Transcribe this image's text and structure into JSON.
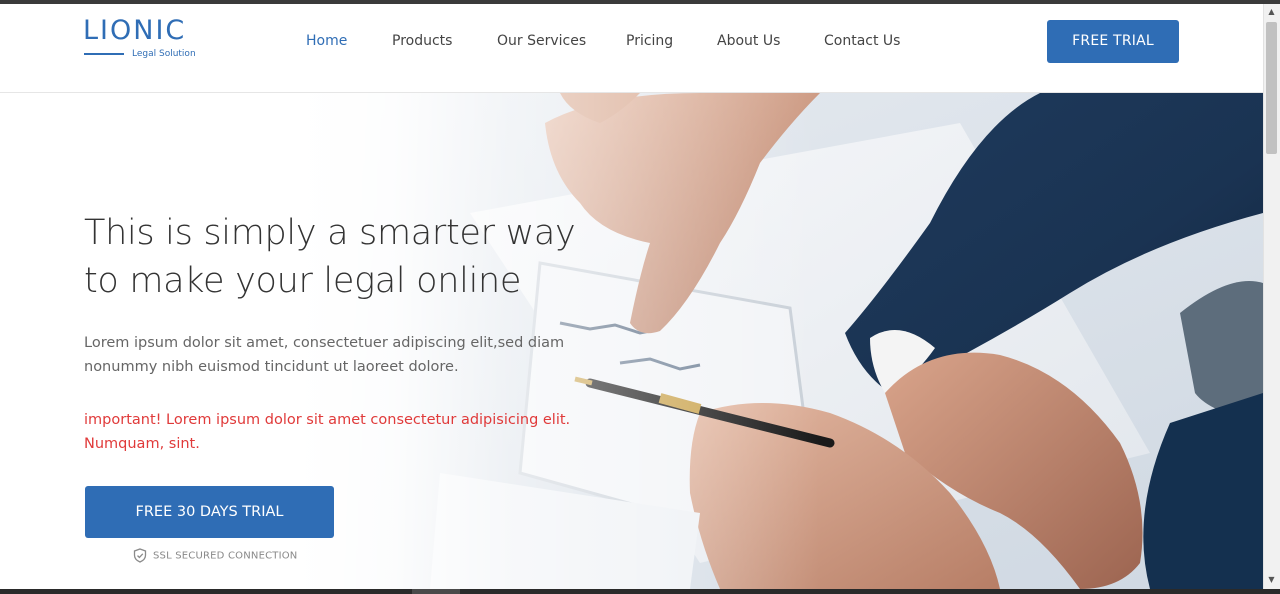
{
  "logo": {
    "name": "LIONIC",
    "tagline": "Legal Solution"
  },
  "nav": {
    "items": [
      {
        "label": "Home",
        "active": true
      },
      {
        "label": "Products",
        "active": false
      },
      {
        "label": "Our Services",
        "active": false
      },
      {
        "label": "Pricing",
        "active": false
      },
      {
        "label": "About Us",
        "active": false
      },
      {
        "label": "Contact Us",
        "active": false
      }
    ],
    "cta_label": "FREE TRIAL"
  },
  "hero": {
    "headline_line1": "This is simply a smarter way",
    "headline_line2": "to make your legal online",
    "description_line1": "Lorem ipsum dolor sit amet, consectetuer adipiscing elit,sed diam",
    "description_line2": "nonummy nibh euismod tincidunt ut laoreet dolore.",
    "important_line1": "important! Lorem ipsum dolor sit amet consectetur adipisicing elit.",
    "important_line2": "Numquam, sint.",
    "cta_label": "FREE 30 DAYS TRIAL",
    "ssl_text": "SSL SECURED CONNECTION",
    "ssl_icon": "shield-check-icon",
    "image": "business-hands-reviewing-documents-photo"
  },
  "colors": {
    "brand": "#2f6db5",
    "warning": "#e03a3a",
    "text": "#333333",
    "muted": "#666666"
  },
  "scrollbar": {
    "up_icon": "scroll-up-arrow-icon",
    "down_icon": "scroll-down-arrow-icon"
  }
}
